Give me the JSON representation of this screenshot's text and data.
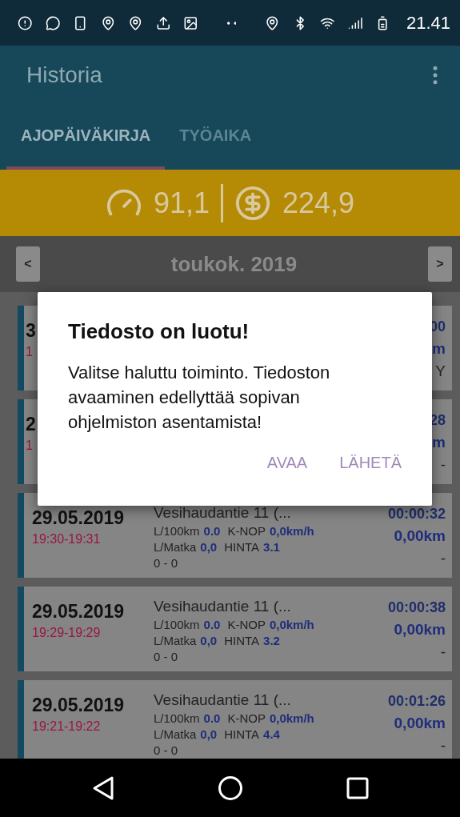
{
  "status_bar": {
    "time": "21.41"
  },
  "app_bar": {
    "title": "Historia"
  },
  "tabs": [
    {
      "label": "AJOPÄIVÄKIRJA",
      "selected": true
    },
    {
      "label": "TYÖAIKA",
      "selected": false
    }
  ],
  "stats": [
    {
      "kind": "speed",
      "value": "91,1"
    },
    {
      "kind": "price",
      "value": "224,9"
    }
  ],
  "month_nav": {
    "prev": "<",
    "label": "toukok. 2019",
    "next": ">"
  },
  "trips": [
    {
      "kind": "partial",
      "date": "3",
      "time": "1",
      "duration": "00",
      "distance": "m",
      "note": "Y"
    },
    {
      "kind": "partial",
      "date": "2",
      "time": "1",
      "duration": "28",
      "distance": "m",
      "note": "-"
    },
    {
      "kind": "full",
      "date": "29.05.2019",
      "time": "19:30-19:31",
      "address": "Vesihaudantie 11 (...",
      "l100_label": "L/100km",
      "l100": "0.0",
      "knop_label": "K-NOP",
      "knop": "0,0km/h",
      "lmatka_label": "L/Matka",
      "lmatka": "0,0",
      "hinta_label": "HINTA",
      "hinta": "3.1",
      "range": "0 - 0",
      "duration": "00:00:32",
      "distance": "0,00km",
      "note": "-"
    },
    {
      "kind": "full",
      "date": "29.05.2019",
      "time": "19:29-19:29",
      "address": "Vesihaudantie 11 (...",
      "l100_label": "L/100km",
      "l100": "0.0",
      "knop_label": "K-NOP",
      "knop": "0,0km/h",
      "lmatka_label": "L/Matka",
      "lmatka": "0,0",
      "hinta_label": "HINTA",
      "hinta": "3.2",
      "range": "0 - 0",
      "duration": "00:00:38",
      "distance": "0,00km",
      "note": "-"
    },
    {
      "kind": "full",
      "date": "29.05.2019",
      "time": "19:21-19:22",
      "address": "Vesihaudantie 11 (...",
      "l100_label": "L/100km",
      "l100": "0.0",
      "knop_label": "K-NOP",
      "knop": "0,0km/h",
      "lmatka_label": "L/Matka",
      "lmatka": "0,0",
      "hinta_label": "HINTA",
      "hinta": "4.4",
      "range": "0 - 0",
      "duration": "00:01:26",
      "distance": "0,00km",
      "note": "-"
    }
  ],
  "dialog": {
    "title": "Tiedosto on luotu!",
    "message": "Valitse haluttu toiminto. Tiedoston avaaminen edellyttää sopivan ohjelmiston asentamista!",
    "buttons": [
      "AVAA",
      "LÄHETÄ"
    ]
  }
}
